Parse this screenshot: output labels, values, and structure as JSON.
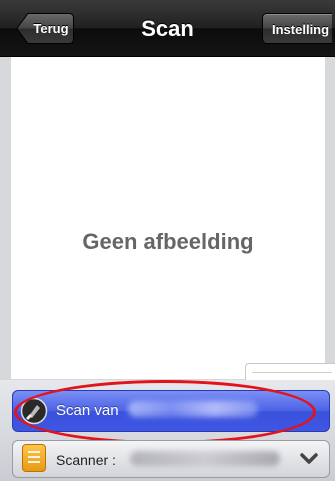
{
  "navbar": {
    "title": "Scan",
    "back_label": "Terug",
    "settings_label": "Instelling"
  },
  "preview": {
    "empty_text": "Geen afbeelding",
    "thumbnail_icon": "chevron-down-icon"
  },
  "scan_button": {
    "label": "Scan van",
    "icon": "scan-icon",
    "color": "#4b62e6"
  },
  "scanner_select": {
    "label": "Scanner :",
    "icon": "scanner-icon",
    "dropdown_icon": "chevron-down-icon"
  },
  "highlight_color": "#e3131b"
}
